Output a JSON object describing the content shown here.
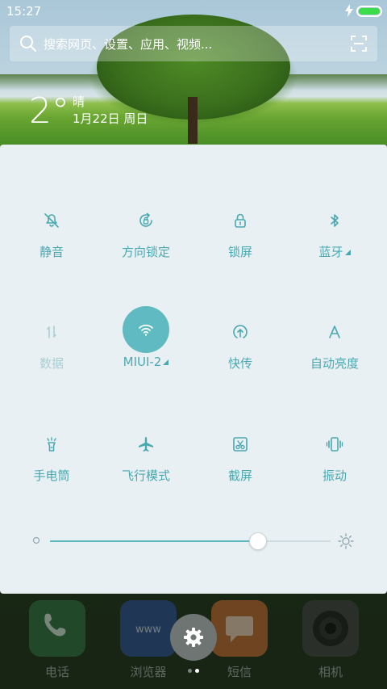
{
  "status_bar": {
    "time": "15:27",
    "battery_color": "#3ddc4a"
  },
  "search": {
    "placeholder": "搜索网页、设置、应用、视频..."
  },
  "weather": {
    "temperature": "2°",
    "condition": "晴",
    "date": "1月22日 周日"
  },
  "toggles": [
    {
      "id": "silent",
      "label": "静音",
      "icon": "bell-off-icon",
      "active": false,
      "dim": false,
      "dropdown": false
    },
    {
      "id": "rotation-lock",
      "label": "方向锁定",
      "icon": "rotation-lock-icon",
      "active": false,
      "dim": false,
      "dropdown": false
    },
    {
      "id": "lock-screen",
      "label": "锁屏",
      "icon": "lock-icon",
      "active": false,
      "dim": false,
      "dropdown": false
    },
    {
      "id": "bluetooth",
      "label": "蓝牙",
      "icon": "bluetooth-icon",
      "active": false,
      "dim": false,
      "dropdown": true
    },
    {
      "id": "data",
      "label": "数据",
      "icon": "mobile-data-icon",
      "active": false,
      "dim": true,
      "dropdown": false
    },
    {
      "id": "wifi",
      "label": "MIUI-2",
      "icon": "wifi-icon",
      "active": true,
      "dim": false,
      "dropdown": true
    },
    {
      "id": "quick-transfer",
      "label": "快传",
      "icon": "quick-transfer-icon",
      "active": false,
      "dim": false,
      "dropdown": false
    },
    {
      "id": "auto-brightness",
      "label": "自动亮度",
      "icon": "auto-brightness-icon",
      "active": false,
      "dim": false,
      "dropdown": false
    },
    {
      "id": "flashlight",
      "label": "手电筒",
      "icon": "flashlight-icon",
      "active": false,
      "dim": false,
      "dropdown": false
    },
    {
      "id": "airplane",
      "label": "飞行模式",
      "icon": "airplane-icon",
      "active": false,
      "dim": false,
      "dropdown": false
    },
    {
      "id": "screenshot",
      "label": "截屏",
      "icon": "screenshot-icon",
      "active": false,
      "dim": false,
      "dropdown": false
    },
    {
      "id": "vibrate",
      "label": "振动",
      "icon": "vibrate-icon",
      "active": false,
      "dim": false,
      "dropdown": false
    }
  ],
  "brightness": {
    "level": 0.74
  },
  "dock": [
    {
      "label": "电话",
      "icon": "phone-icon",
      "color": "#2f6b3c"
    },
    {
      "label": "浏览器",
      "icon": "browser-icon",
      "color": "#2b4a8a"
    },
    {
      "label": "短信",
      "icon": "messages-icon",
      "color": "#b9652a"
    },
    {
      "label": "相机",
      "icon": "camera-icon",
      "color": "#3d3d3d"
    }
  ],
  "colors": {
    "accent": "#5fbac1",
    "panel_bg": "#e9f0f3"
  }
}
